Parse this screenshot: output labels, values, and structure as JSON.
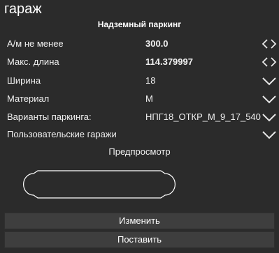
{
  "window": {
    "title": "гараж"
  },
  "section": {
    "title": "Надземный паркинг"
  },
  "params": [
    {
      "label": "А/м не менее",
      "value": "300.0",
      "control": "stepper"
    },
    {
      "label": "Макс. длина",
      "value": "114.379997",
      "control": "stepper"
    },
    {
      "label": "Ширина",
      "value": "18",
      "control": "dropdown"
    },
    {
      "label": "Материал",
      "value": "М",
      "control": "dropdown"
    },
    {
      "label": "Варианты паркинга:",
      "value": "НПГ18_ОТКР_М_9_17_540",
      "control": "dropdown"
    },
    {
      "label": "Пользовательские гаражи",
      "value": "",
      "control": "dropdown"
    }
  ],
  "preview": {
    "label": "Предпросмотр"
  },
  "buttons": {
    "modify": "Изменить",
    "place": "Поставить"
  },
  "colors": {
    "background": "#2b2b2b",
    "button": "#3e3e3e",
    "text": "#f0f0f0"
  }
}
